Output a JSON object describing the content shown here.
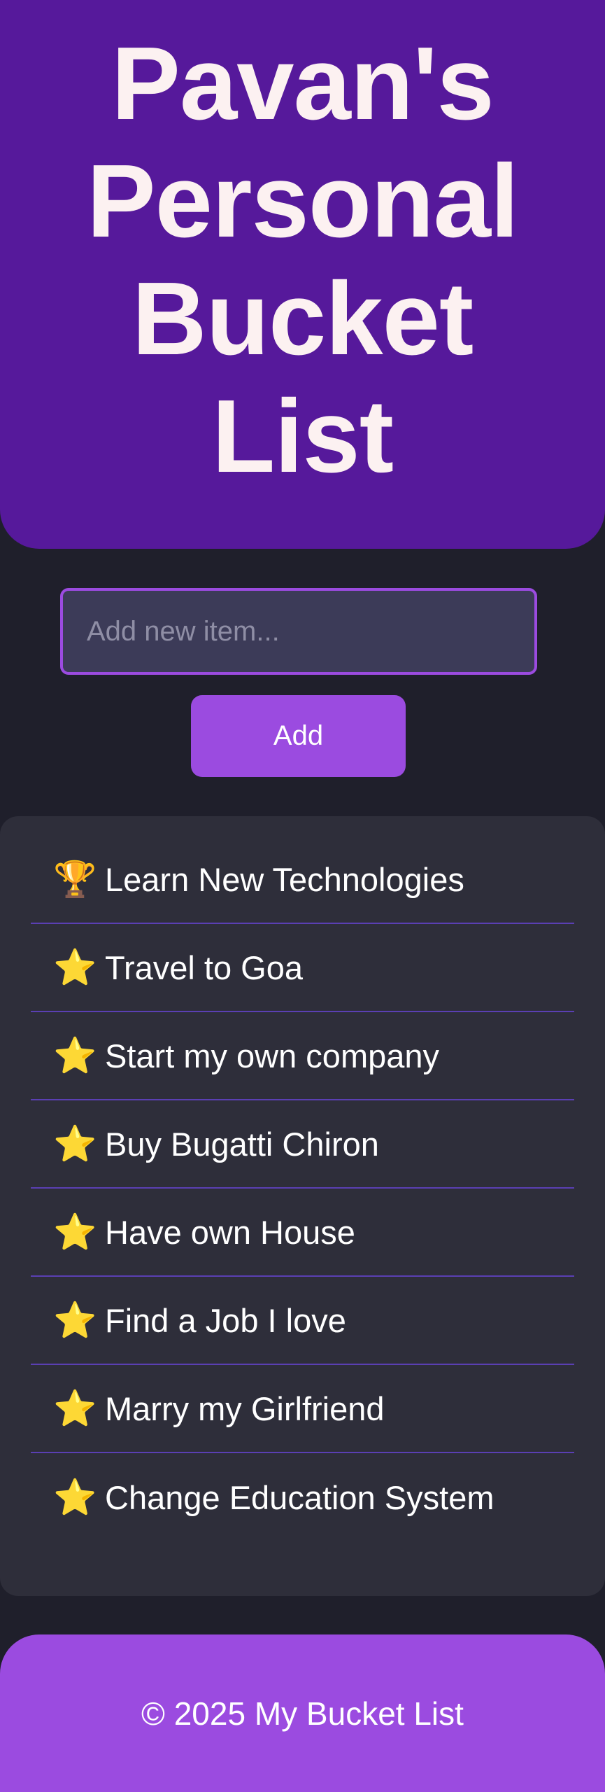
{
  "header": {
    "title": "Pavan's Personal Bucket List"
  },
  "form": {
    "input_value": "",
    "input_placeholder": "Add new item...",
    "add_label": "Add"
  },
  "list": {
    "items": [
      {
        "icon": "trophy-icon",
        "glyph": "🏆",
        "label": "Learn New Technologies"
      },
      {
        "icon": "star-icon",
        "glyph": "⭐",
        "label": "Travel to Goa"
      },
      {
        "icon": "star-icon",
        "glyph": "⭐",
        "label": "Start my own company"
      },
      {
        "icon": "star-icon",
        "glyph": "⭐",
        "label": "Buy Bugatti Chiron"
      },
      {
        "icon": "star-icon",
        "glyph": "⭐",
        "label": "Have own House"
      },
      {
        "icon": "star-icon",
        "glyph": "⭐",
        "label": "Find a Job I love"
      },
      {
        "icon": "star-icon",
        "glyph": "⭐",
        "label": "Marry my Girlfriend"
      },
      {
        "icon": "star-icon",
        "glyph": "⭐",
        "label": "Change Education System"
      }
    ]
  },
  "footer": {
    "text": "© 2025 My Bucket List"
  },
  "colors": {
    "header_bg": "#56199b",
    "accent": "#9b4be0",
    "page_bg": "#1f1f2b",
    "card_bg": "#2e2e3a",
    "input_bg": "#3c3b58",
    "divider": "#5a3fb3",
    "title_text": "#fcf1f1"
  }
}
